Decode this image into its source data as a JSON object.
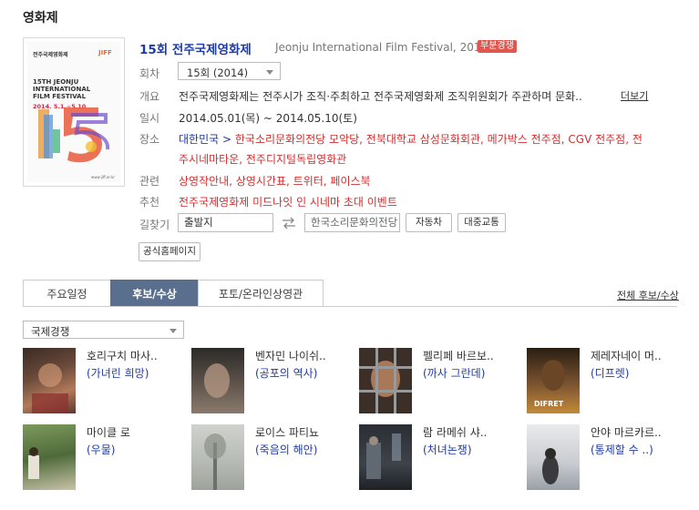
{
  "section_title": "영화제",
  "festival": {
    "title": "15회 전주국제영화제",
    "english_title": "Jeonju International Film Festival, 2014",
    "badge": "부분경쟁",
    "poster_lines": [
      "전주국제영화제",
      "JIFF",
      "15TH JEONJU",
      "INTERNATIONAL",
      "FILM FESTIVAL",
      "2014. 5.1.~5.10"
    ]
  },
  "labels": {
    "round": "회차",
    "overview": "개요",
    "date": "일시",
    "venue": "장소",
    "related": "관련",
    "recommend": "추천",
    "directions": "길찾기"
  },
  "round_select": "15회 (2014)",
  "overview_text": "전주국제영화제는 전주시가 조직·주최하고 전주국제영화제 조직위원회가 주관하며 문화..",
  "more_link": "더보기",
  "date_text": "2014.05.01(목) ~ 2014.05.10(토)",
  "venue": {
    "prefix": "대한민국 >",
    "line1": "한국소리문화의전당 모악당, 전북대학교 삼성문화회관, 메가박스 전주점, CGV 전주점, 전",
    "line2": "주시네마타운, 전주디지털독립영화관"
  },
  "related_text": "상영작안내, 상영시간표, 트위터, 페이스북",
  "recommend_text": "전주국제영화제 미드나잇 인 시네마 초대 이벤트",
  "directions": {
    "origin_value": "출발지",
    "destination_value": "한국소리문화의전당",
    "car_button": "자동차",
    "transit_button": "대중교통"
  },
  "official_button": "공식홈페이지",
  "tabs": [
    "주요일정",
    "후보/수상",
    "포토/온라인상영관"
  ],
  "all_link": "전체 후보/수상",
  "category_select": "국제경쟁",
  "films": [
    {
      "name": "호리구치 마사..",
      "film": "(가녀린 희망)"
    },
    {
      "name": "벤자민 나이쉬..",
      "film": "(공포의 역사)"
    },
    {
      "name": "펠리페 바르보..",
      "film": "(까사 그란데)"
    },
    {
      "name": "제레자네이 머..",
      "film": "(디프렛)"
    },
    {
      "name": "마이클 로",
      "film": "(우물)"
    },
    {
      "name": "로이스 파티뇨",
      "film": "(죽음의 해안)"
    },
    {
      "name": "람 라메쉬 샤..",
      "film": "(처녀논쟁)"
    },
    {
      "name": "안야 마르카르..",
      "film": "(통제할 수 ..)"
    }
  ],
  "difret_caption": "DIFRET"
}
